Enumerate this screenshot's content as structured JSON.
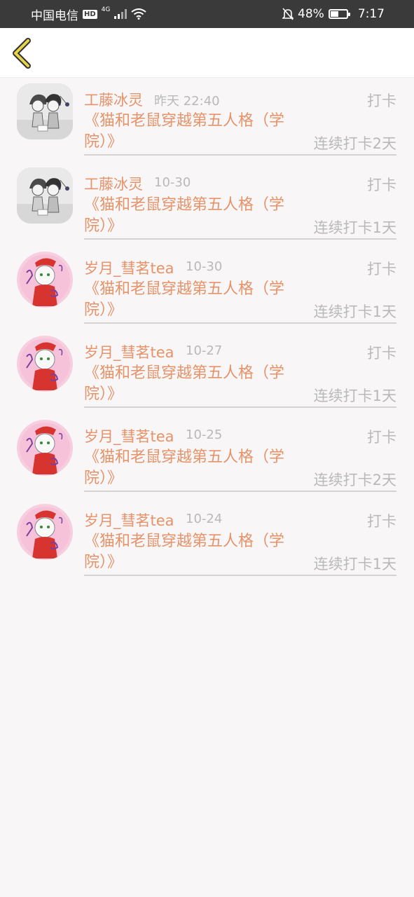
{
  "status_bar": {
    "carrier": "中国电信",
    "hd": "HD",
    "network": "4G",
    "battery_percent": "48%",
    "time": "7:17"
  },
  "header": {
    "back_icon": "chevron-left-icon"
  },
  "colors": {
    "accent": "#e6936a",
    "muted": "#b9b9b9",
    "back_icon": "#e8d44a"
  },
  "records": [
    {
      "name": "工藤冰灵",
      "time": "昨天 22:40",
      "tag": "打卡",
      "title": "《猫和老鼠穿越第五人格（学院）》",
      "streak": "连续打卡2天",
      "avatar": "sketch-avatar"
    },
    {
      "name": "工藤冰灵",
      "time": "10-30",
      "tag": "打卡",
      "title": "《猫和老鼠穿越第五人格（学院）》",
      "streak": "连续打卡1天",
      "avatar": "sketch-avatar"
    },
    {
      "name": "岁月_彗茗tea",
      "time": "10-30",
      "tag": "打卡",
      "title": "《猫和老鼠穿越第五人格（学院）》",
      "streak": "连续打卡1天",
      "avatar": "pink-cat-avatar"
    },
    {
      "name": "岁月_彗茗tea",
      "time": "10-27",
      "tag": "打卡",
      "title": "《猫和老鼠穿越第五人格（学院）》",
      "streak": "连续打卡1天",
      "avatar": "pink-cat-avatar"
    },
    {
      "name": "岁月_彗茗tea",
      "time": "10-25",
      "tag": "打卡",
      "title": "《猫和老鼠穿越第五人格（学院）》",
      "streak": "连续打卡2天",
      "avatar": "pink-cat-avatar"
    },
    {
      "name": "岁月_彗茗tea",
      "time": "10-24",
      "tag": "打卡",
      "title": "《猫和老鼠穿越第五人格（学院）》",
      "streak": "连续打卡1天",
      "avatar": "pink-cat-avatar"
    }
  ]
}
